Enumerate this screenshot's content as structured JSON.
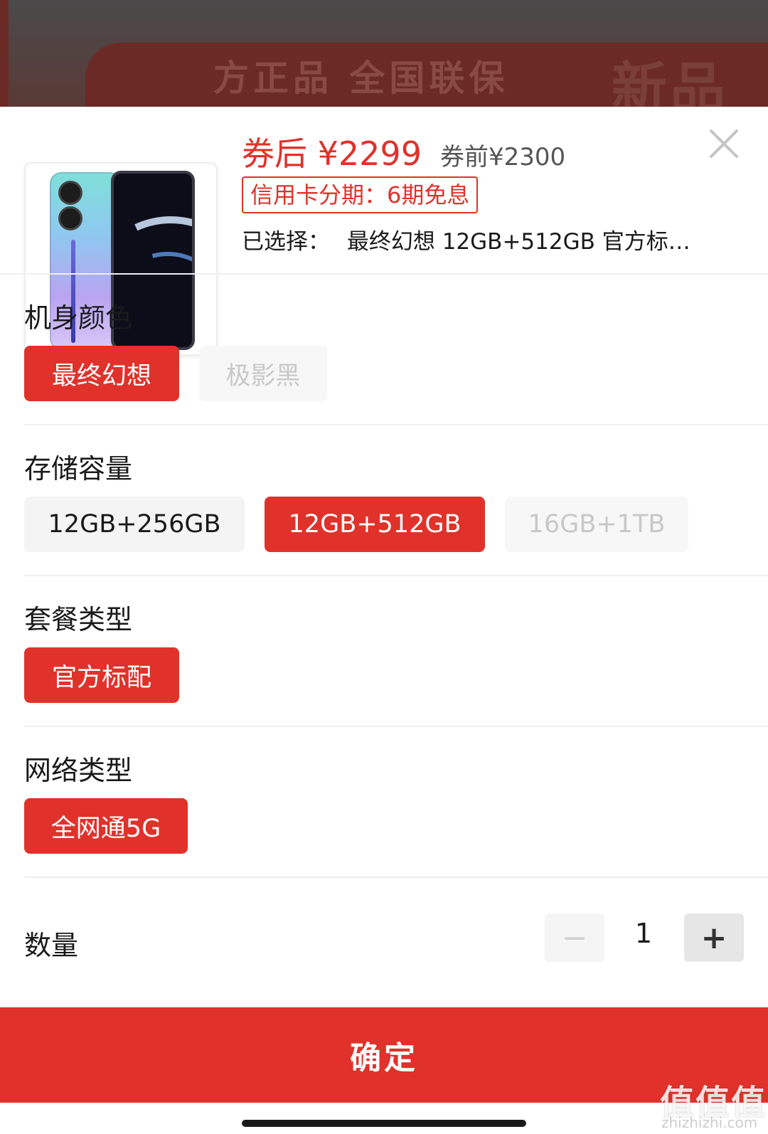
{
  "backdrop": {
    "banner_text": "方正品 全国联保",
    "banner_new": "新品"
  },
  "product": {
    "image_alt": "realme phone"
  },
  "price": {
    "after_coupon": "券后 ¥2299",
    "before_coupon": "券前¥2300",
    "installment_badge": "信用卡分期：6期免息"
  },
  "selected": {
    "label": "已选择：",
    "value": "最终幻想 12GB+512GB 官方标…"
  },
  "sections": {
    "color": {
      "title": "机身颜色",
      "options": [
        "最终幻想",
        "极影黑"
      ]
    },
    "storage": {
      "title": "存储容量",
      "options": [
        "12GB+256GB",
        "12GB+512GB",
        "16GB+1TB"
      ]
    },
    "package": {
      "title": "套餐类型",
      "options": [
        "官方标配"
      ]
    },
    "network": {
      "title": "网络类型",
      "options": [
        "全网通5G"
      ]
    }
  },
  "quantity": {
    "label": "数量",
    "value": "1",
    "minus": "−",
    "plus": "+"
  },
  "confirm_label": "确定",
  "watermark": {
    "main": "值值值",
    "sub": "zhizhizhi.com"
  },
  "colors": {
    "accent": "#e0322b",
    "option_bg": "#f4f4f4",
    "disabled_text": "#c8c8c8"
  }
}
